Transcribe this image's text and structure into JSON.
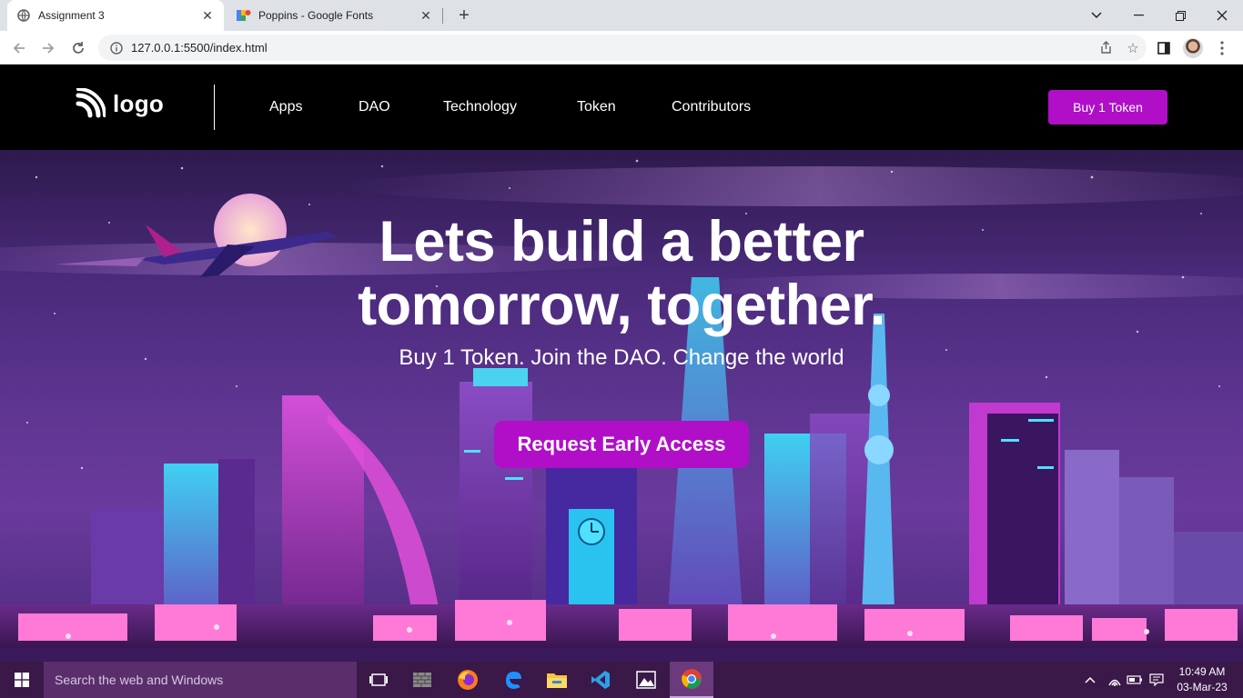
{
  "browser": {
    "tabs": [
      {
        "title": "Assignment 3",
        "active": true
      },
      {
        "title": "Poppins - Google Fonts",
        "active": false
      }
    ],
    "url": "127.0.0.1:5500/index.html"
  },
  "site": {
    "logo_text": "logo",
    "nav": [
      "Apps",
      "DAO",
      "Technology",
      "Token",
      "Contributors"
    ],
    "buy_button": "Buy 1 Token"
  },
  "hero": {
    "title": "Lets build a better tomorrow, together.",
    "subtitle": "Buy 1 Token. Join the DAO. Change the world",
    "cta": "Request Early Access"
  },
  "taskbar": {
    "search_placeholder": "Search the web and Windows",
    "time": "10:49 AM",
    "date": "03-Mar-23",
    "apps": [
      "task-view-icon",
      "firewall-icon",
      "firefox-icon",
      "edge-icon",
      "file-explorer-icon",
      "vscode-icon",
      "photos-icon",
      "chrome-icon"
    ]
  },
  "colors": {
    "accent": "#b00fc7",
    "header_bg": "#000000",
    "taskbar_bg": "#3a1848"
  }
}
